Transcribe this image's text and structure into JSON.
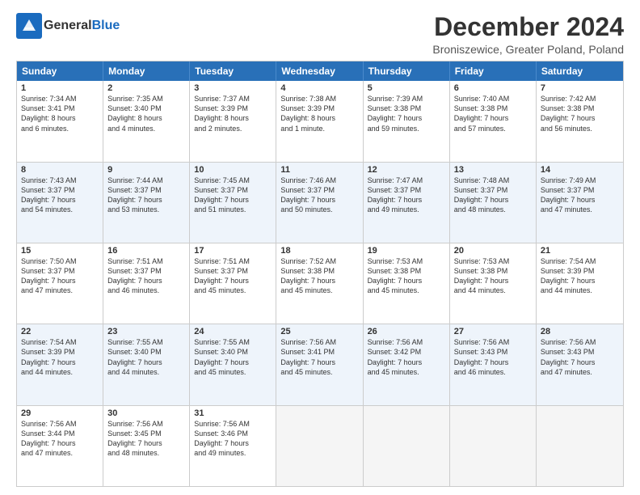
{
  "logo": {
    "line1": "General",
    "line2": "Blue"
  },
  "title": "December 2024",
  "subtitle": "Broniszewice, Greater Poland, Poland",
  "days": [
    "Sunday",
    "Monday",
    "Tuesday",
    "Wednesday",
    "Thursday",
    "Friday",
    "Saturday"
  ],
  "rows": [
    [
      {
        "num": "1",
        "lines": [
          "Sunrise: 7:34 AM",
          "Sunset: 3:41 PM",
          "Daylight: 8 hours",
          "and 6 minutes."
        ]
      },
      {
        "num": "2",
        "lines": [
          "Sunrise: 7:35 AM",
          "Sunset: 3:40 PM",
          "Daylight: 8 hours",
          "and 4 minutes."
        ]
      },
      {
        "num": "3",
        "lines": [
          "Sunrise: 7:37 AM",
          "Sunset: 3:39 PM",
          "Daylight: 8 hours",
          "and 2 minutes."
        ]
      },
      {
        "num": "4",
        "lines": [
          "Sunrise: 7:38 AM",
          "Sunset: 3:39 PM",
          "Daylight: 8 hours",
          "and 1 minute."
        ]
      },
      {
        "num": "5",
        "lines": [
          "Sunrise: 7:39 AM",
          "Sunset: 3:38 PM",
          "Daylight: 7 hours",
          "and 59 minutes."
        ]
      },
      {
        "num": "6",
        "lines": [
          "Sunrise: 7:40 AM",
          "Sunset: 3:38 PM",
          "Daylight: 7 hours",
          "and 57 minutes."
        ]
      },
      {
        "num": "7",
        "lines": [
          "Sunrise: 7:42 AM",
          "Sunset: 3:38 PM",
          "Daylight: 7 hours",
          "and 56 minutes."
        ]
      }
    ],
    [
      {
        "num": "8",
        "lines": [
          "Sunrise: 7:43 AM",
          "Sunset: 3:37 PM",
          "Daylight: 7 hours",
          "and 54 minutes."
        ]
      },
      {
        "num": "9",
        "lines": [
          "Sunrise: 7:44 AM",
          "Sunset: 3:37 PM",
          "Daylight: 7 hours",
          "and 53 minutes."
        ]
      },
      {
        "num": "10",
        "lines": [
          "Sunrise: 7:45 AM",
          "Sunset: 3:37 PM",
          "Daylight: 7 hours",
          "and 51 minutes."
        ]
      },
      {
        "num": "11",
        "lines": [
          "Sunrise: 7:46 AM",
          "Sunset: 3:37 PM",
          "Daylight: 7 hours",
          "and 50 minutes."
        ]
      },
      {
        "num": "12",
        "lines": [
          "Sunrise: 7:47 AM",
          "Sunset: 3:37 PM",
          "Daylight: 7 hours",
          "and 49 minutes."
        ]
      },
      {
        "num": "13",
        "lines": [
          "Sunrise: 7:48 AM",
          "Sunset: 3:37 PM",
          "Daylight: 7 hours",
          "and 48 minutes."
        ]
      },
      {
        "num": "14",
        "lines": [
          "Sunrise: 7:49 AM",
          "Sunset: 3:37 PM",
          "Daylight: 7 hours",
          "and 47 minutes."
        ]
      }
    ],
    [
      {
        "num": "15",
        "lines": [
          "Sunrise: 7:50 AM",
          "Sunset: 3:37 PM",
          "Daylight: 7 hours",
          "and 47 minutes."
        ]
      },
      {
        "num": "16",
        "lines": [
          "Sunrise: 7:51 AM",
          "Sunset: 3:37 PM",
          "Daylight: 7 hours",
          "and 46 minutes."
        ]
      },
      {
        "num": "17",
        "lines": [
          "Sunrise: 7:51 AM",
          "Sunset: 3:37 PM",
          "Daylight: 7 hours",
          "and 45 minutes."
        ]
      },
      {
        "num": "18",
        "lines": [
          "Sunrise: 7:52 AM",
          "Sunset: 3:38 PM",
          "Daylight: 7 hours",
          "and 45 minutes."
        ]
      },
      {
        "num": "19",
        "lines": [
          "Sunrise: 7:53 AM",
          "Sunset: 3:38 PM",
          "Daylight: 7 hours",
          "and 45 minutes."
        ]
      },
      {
        "num": "20",
        "lines": [
          "Sunrise: 7:53 AM",
          "Sunset: 3:38 PM",
          "Daylight: 7 hours",
          "and 44 minutes."
        ]
      },
      {
        "num": "21",
        "lines": [
          "Sunrise: 7:54 AM",
          "Sunset: 3:39 PM",
          "Daylight: 7 hours",
          "and 44 minutes."
        ]
      }
    ],
    [
      {
        "num": "22",
        "lines": [
          "Sunrise: 7:54 AM",
          "Sunset: 3:39 PM",
          "Daylight: 7 hours",
          "and 44 minutes."
        ]
      },
      {
        "num": "23",
        "lines": [
          "Sunrise: 7:55 AM",
          "Sunset: 3:40 PM",
          "Daylight: 7 hours",
          "and 44 minutes."
        ]
      },
      {
        "num": "24",
        "lines": [
          "Sunrise: 7:55 AM",
          "Sunset: 3:40 PM",
          "Daylight: 7 hours",
          "and 45 minutes."
        ]
      },
      {
        "num": "25",
        "lines": [
          "Sunrise: 7:56 AM",
          "Sunset: 3:41 PM",
          "Daylight: 7 hours",
          "and 45 minutes."
        ]
      },
      {
        "num": "26",
        "lines": [
          "Sunrise: 7:56 AM",
          "Sunset: 3:42 PM",
          "Daylight: 7 hours",
          "and 45 minutes."
        ]
      },
      {
        "num": "27",
        "lines": [
          "Sunrise: 7:56 AM",
          "Sunset: 3:43 PM",
          "Daylight: 7 hours",
          "and 46 minutes."
        ]
      },
      {
        "num": "28",
        "lines": [
          "Sunrise: 7:56 AM",
          "Sunset: 3:43 PM",
          "Daylight: 7 hours",
          "and 47 minutes."
        ]
      }
    ],
    [
      {
        "num": "29",
        "lines": [
          "Sunrise: 7:56 AM",
          "Sunset: 3:44 PM",
          "Daylight: 7 hours",
          "and 47 minutes."
        ]
      },
      {
        "num": "30",
        "lines": [
          "Sunrise: 7:56 AM",
          "Sunset: 3:45 PM",
          "Daylight: 7 hours",
          "and 48 minutes."
        ]
      },
      {
        "num": "31",
        "lines": [
          "Sunrise: 7:56 AM",
          "Sunset: 3:46 PM",
          "Daylight: 7 hours",
          "and 49 minutes."
        ]
      },
      {
        "num": "",
        "lines": []
      },
      {
        "num": "",
        "lines": []
      },
      {
        "num": "",
        "lines": []
      },
      {
        "num": "",
        "lines": []
      }
    ]
  ]
}
